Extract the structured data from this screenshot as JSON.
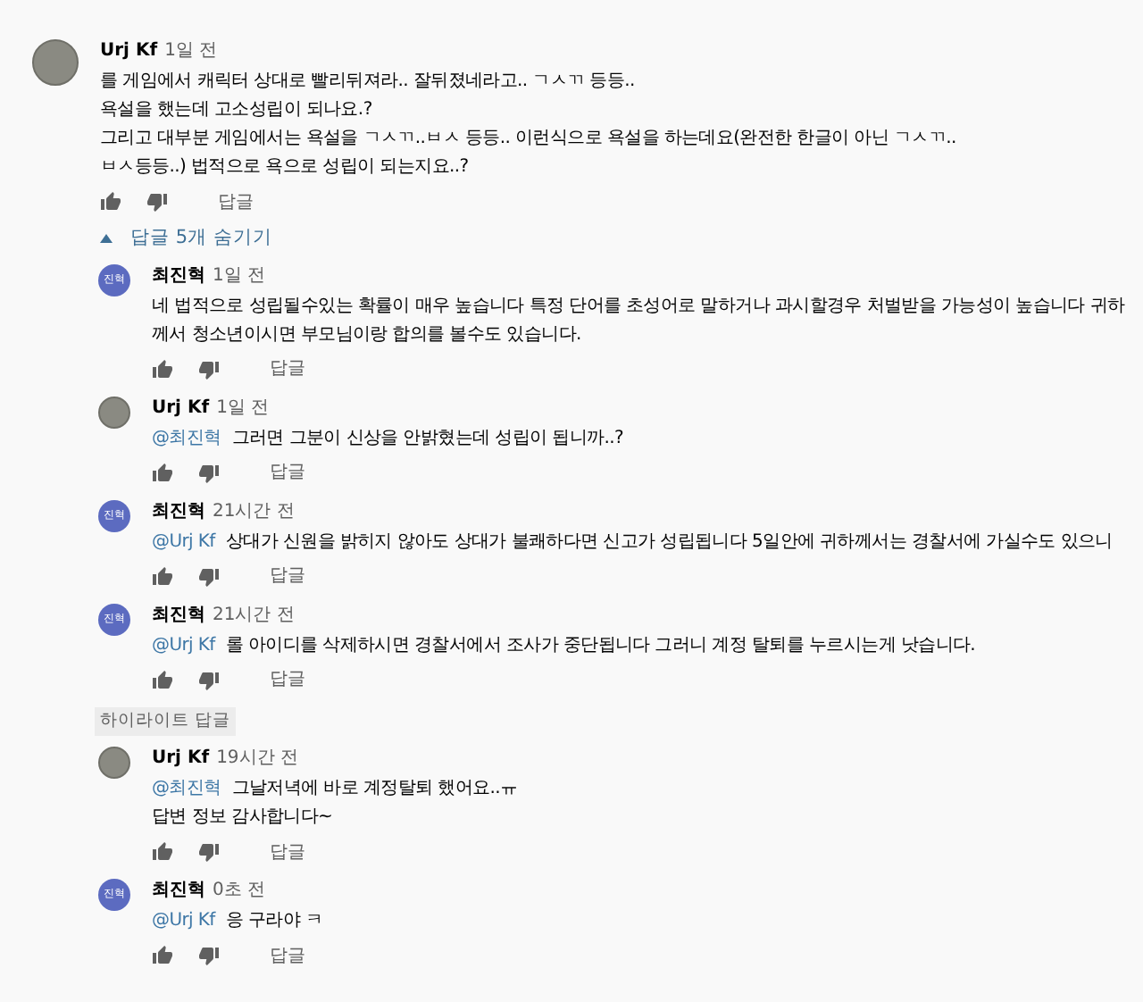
{
  "comment": {
    "author": "Urj Kf",
    "time": "1일 전",
    "avatar": {
      "kind": "photo"
    },
    "lines": [
      "를 게임에서  캐릭터 상대로 빨리뒤져라..  잘뒤졌네라고.. ㄱㅅㄲ 등등..",
      "욕설을 했는데 고소성립이 되나요.?",
      "그리고 대부분 게임에서는 욕설을  ㄱㅅㄲ..ㅂㅅ 등등.. 이런식으로 욕설을 하는데요(완전한 한글이 아닌 ㄱㅅㄲ..",
      "ㅂㅅ등등..) 법적으로 욕으로 성립이 되는지요..?"
    ],
    "reply_label": "답글"
  },
  "replies_toggle": {
    "label": "답글 5개 숨기기",
    "expanded": true
  },
  "replies": [
    {
      "author": "최진혁",
      "time": "1일 전",
      "avatar": {
        "kind": "initials",
        "text": "진혁"
      },
      "lines": [
        "네 법적으로 성립될수있는 확률이 매우 높습니다 특정 단어를 초성어로 말하거나 과시할경우 처벌받을 가능성이 높습니다 귀하께서 청소년이시면 부모님이랑 합의를 볼수도 있습니다."
      ],
      "reply_label": "답글"
    },
    {
      "author": "Urj Kf",
      "time": "1일 전",
      "avatar": {
        "kind": "photo"
      },
      "mention": "@최진혁",
      "lines": [
        "그러면 그분이 신상을 안밝혔는데 성립이 됩니까..?"
      ],
      "reply_label": "답글"
    },
    {
      "author": "최진혁",
      "time": "21시간 전",
      "avatar": {
        "kind": "initials",
        "text": "진혁"
      },
      "mention": "@Urj Kf",
      "lines": [
        "상대가 신원을 밝히지 않아도 상대가 불쾌하다면 신고가 성립됩니다 5일안에 귀하께서는 경찰서에 가실수도 있으니"
      ],
      "reply_label": "답글"
    },
    {
      "author": "최진혁",
      "time": "21시간 전",
      "avatar": {
        "kind": "initials",
        "text": "진혁"
      },
      "mention": "@Urj Kf",
      "lines": [
        "롤 아이디를 삭제하시면 경찰서에서 조사가 중단됩니다 그러니 계정 탈퇴를 누르시는게 낫습니다."
      ],
      "reply_label": "답글"
    },
    {
      "highlight_label": "하이라이트 답글",
      "author": "Urj Kf",
      "time": "19시간 전",
      "avatar": {
        "kind": "photo"
      },
      "mention": "@최진혁",
      "lines": [
        "그날저녁에 바로 계정탈퇴 했어요..ㅠ",
        "답변 정보 감사합니다~"
      ],
      "reply_label": "답글"
    },
    {
      "author": "최진혁",
      "time": "0초 전",
      "avatar": {
        "kind": "initials",
        "text": "진혁"
      },
      "mention": "@Urj Kf",
      "lines": [
        "응 구라야 ㅋ"
      ],
      "reply_label": "답글"
    }
  ]
}
